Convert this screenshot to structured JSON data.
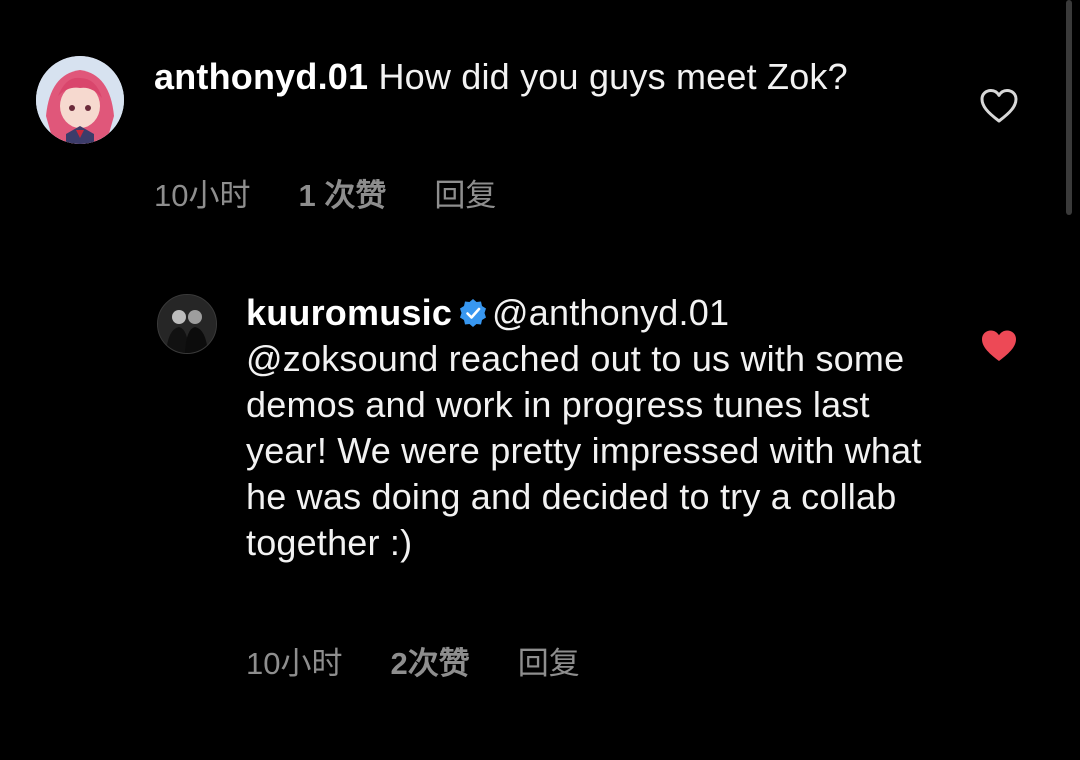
{
  "comments": [
    {
      "username": "anthonyd.01",
      "text": "How did you guys meet Zok?",
      "time": "10小时",
      "likes": "1 次赞",
      "reply": "回复",
      "liked": false
    },
    {
      "username": "kuuromusic",
      "verified": true,
      "mention": "@anthonyd.01",
      "text": "@zoksound reached out to us with some demos and work in progress tunes last year! We were pretty impressed with what he was doing and decided to try a collab together :)",
      "time": "10小时",
      "likes": "2次赞",
      "reply": "回复",
      "liked": true
    }
  ],
  "colors": {
    "background": "#000000",
    "heart_liked": "#ed4956",
    "verified_badge": "#3897f0",
    "meta_text": "#8e8e8e"
  }
}
